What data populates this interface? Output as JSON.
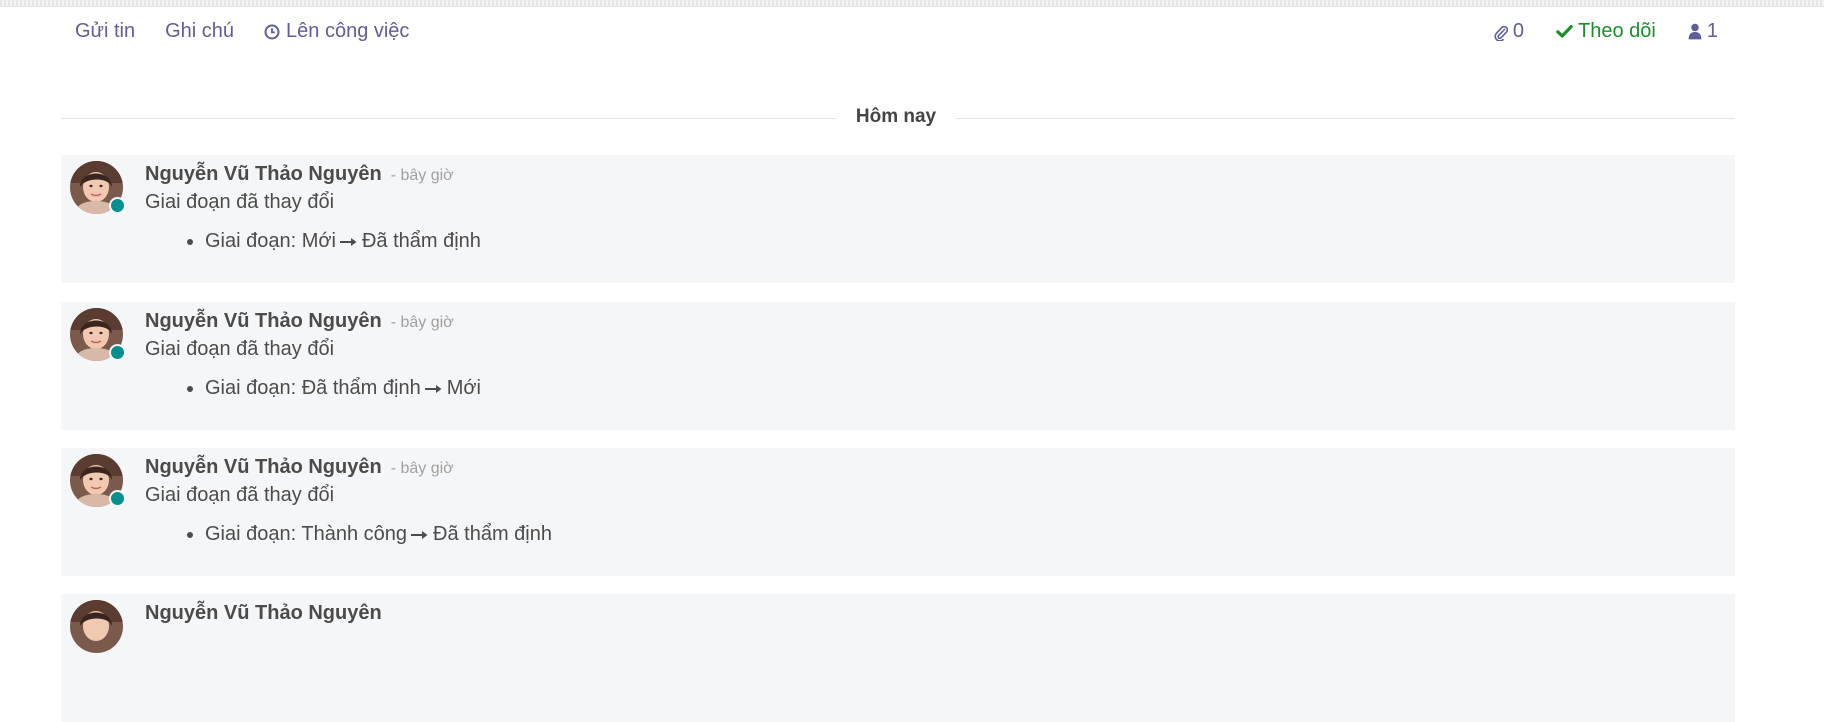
{
  "toolbar": {
    "send_message": "Gửi tin",
    "log_note": "Ghi chú",
    "schedule_activity": "Lên công việc",
    "attachments_count": "0",
    "follow_label": "Theo dõi",
    "followers_count": "1"
  },
  "divider": {
    "label": "Hôm nay"
  },
  "messages": [
    {
      "author": "Nguyễn Vũ Thảo Nguyên",
      "time": "- bây giờ",
      "body": "Giai đoạn đã thay đổi",
      "field_label": "Giai đoạn:",
      "old_value": "Mới",
      "new_value": "Đã thẩm định"
    },
    {
      "author": "Nguyễn Vũ Thảo Nguyên",
      "time": "- bây giờ",
      "body": "Giai đoạn đã thay đổi",
      "field_label": "Giai đoạn:",
      "old_value": "Đã thẩm định",
      "new_value": "Mới"
    },
    {
      "author": "Nguyễn Vũ Thảo Nguyên",
      "time": "- bây giờ",
      "body": "Giai đoạn đã thay đổi",
      "field_label": "Giai đoạn:",
      "old_value": "Thành công",
      "new_value": "Đã thẩm định"
    },
    {
      "author": "Nguyễn Vũ Thảo Nguyên",
      "time": "",
      "body": "",
      "field_label": "",
      "old_value": "",
      "new_value": ""
    }
  ],
  "icons": {
    "clock": "clock-icon",
    "paperclip": "paperclip-icon",
    "check": "check-icon",
    "user": "user-icon",
    "arrow": "long-arrow-right-icon"
  },
  "colors": {
    "link": "#5f5e97",
    "follow": "#1a8f2a",
    "presence": "#00918f",
    "message_bg": "#f5f6f8"
  }
}
